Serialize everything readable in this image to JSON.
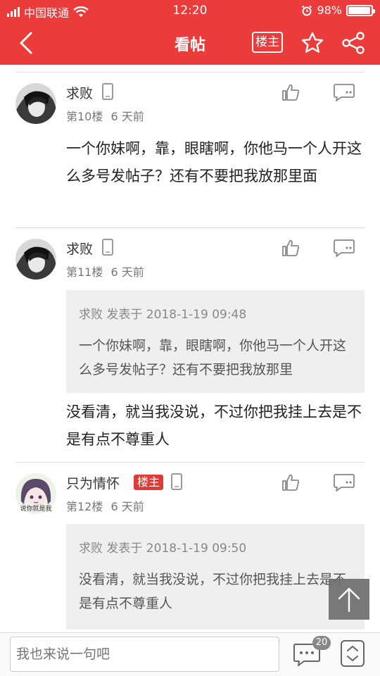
{
  "status_bar": {
    "carrier": "中国联通",
    "time": "12:20",
    "battery_percent": "98%",
    "battery_level": 0.98
  },
  "navbar": {
    "title": "看帖",
    "louzhu_label": "楼主"
  },
  "posts": [
    {
      "username": "求败",
      "floor": "第10楼",
      "time_ago": "6 天前",
      "text": "一个你妹啊，靠，眼瞎啊，你他马一个人开这么多号发帖子？还有不要把我放那里面"
    },
    {
      "username": "求败",
      "floor": "第11楼",
      "time_ago": "6 天前",
      "quote": {
        "meta": "求败 发表于 2018-1-19 09:48",
        "text": "一个你妹啊，靠，眼瞎啊，你他马一个人开这么多号发帖子？还有不要把我放那里"
      },
      "text": "没看清，就当我没说，不过你把我挂上去是不是有点不尊重人"
    },
    {
      "username": "只为情怀",
      "badge": "楼主",
      "floor": "第12楼",
      "time_ago": "6 天前",
      "avatar_caption": "说你就是我",
      "quote": {
        "meta": "求败 发表于 2018-1-19 09:50",
        "text": "没看清，就当我没说，不过你把我挂上去是不是有点不尊重人"
      }
    }
  ],
  "bottom_bar": {
    "input_placeholder": "我也来说一句吧",
    "comment_count": "20"
  },
  "colors": {
    "brand_red": "#ec3b3b",
    "badge_red": "#e03a36"
  },
  "icons": [
    "signal-icon",
    "wifi-icon",
    "alarm-icon",
    "battery-icon",
    "back-icon",
    "star-icon",
    "share-icon",
    "phone-icon",
    "like-icon",
    "reply-icon",
    "arrow-up-icon",
    "comments-icon",
    "jump-icon"
  ]
}
